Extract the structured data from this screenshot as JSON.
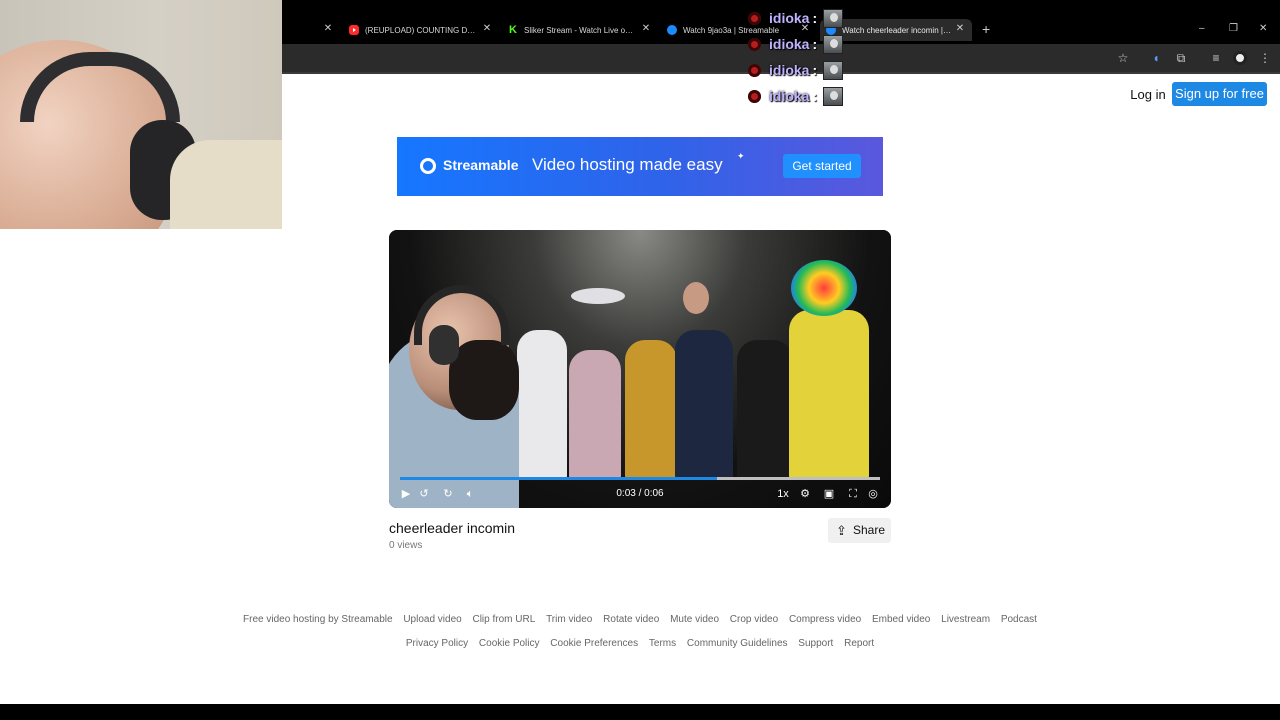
{
  "browser": {
    "tabs": [
      {
        "label": "",
        "favicon": "none"
      },
      {
        "label": "(REUPLOAD) COUNTING DOWN",
        "favicon": "youtube-icon"
      },
      {
        "label": "Sliker Stream - Watch Live on Ki",
        "favicon": "kick-icon"
      },
      {
        "label": "Watch 9jao3a | Streamable",
        "favicon": "streamable-icon"
      },
      {
        "label": "Watch cheerleader incomin | Str",
        "favicon": "streamable-icon",
        "active": true
      }
    ],
    "new_tab_glyph": "+",
    "window_controls": [
      "–",
      "❐",
      "✕"
    ],
    "toolbar_icons": [
      "star-icon",
      "audio-icon",
      "extensions-icon",
      "media-icon",
      "profile-icon",
      "menu-icon"
    ]
  },
  "chat_overlay": {
    "messages": [
      {
        "user": "idioka",
        "sep": ":"
      },
      {
        "user": "idioka",
        "sep": ":"
      },
      {
        "user": "idioka",
        "sep": ":"
      },
      {
        "user": "idioka",
        "sep": ":"
      }
    ]
  },
  "header": {
    "login": "Log in",
    "signup": "Sign up for free"
  },
  "banner": {
    "brand": "Streamable",
    "tagline": "Video hosting made easy",
    "cta": "Get started"
  },
  "player": {
    "time": "0:03 / 0:06",
    "speed": "1x",
    "progress_fraction": 0.66
  },
  "video": {
    "title": "cheerleader incomin",
    "views": "0 views",
    "share": "Share"
  },
  "footer": {
    "row1": [
      "Free video hosting by Streamable",
      "Upload video",
      "Clip from URL",
      "Trim video",
      "Rotate video",
      "Mute video",
      "Crop video",
      "Compress video",
      "Embed video",
      "Livestream",
      "Podcast"
    ],
    "row2": [
      "Privacy Policy",
      "Cookie Policy",
      "Cookie Preferences",
      "Terms",
      "Community Guidelines",
      "Support",
      "Report"
    ]
  },
  "colors": {
    "accent": "#1e88e5",
    "banner_start": "#1677ff",
    "banner_end": "#5a58dd",
    "chat_name": "#bfb2ff"
  }
}
